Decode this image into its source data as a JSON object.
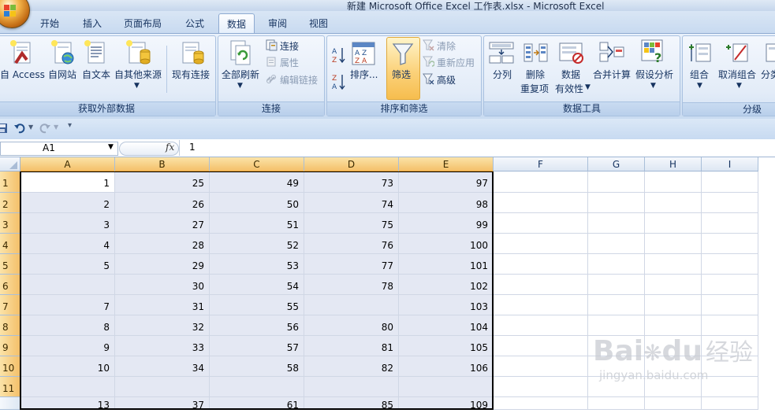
{
  "window": {
    "title": "新建 Microsoft Office Excel 工作表.xlsx - Microsoft Excel"
  },
  "tabs": [
    {
      "label": "开始"
    },
    {
      "label": "插入"
    },
    {
      "label": "页面布局"
    },
    {
      "label": "公式"
    },
    {
      "label": "数据",
      "active": true
    },
    {
      "label": "审阅"
    },
    {
      "label": "视图"
    }
  ],
  "ribbon": {
    "external": {
      "group_label": "获取外部数据",
      "access": "自 Access",
      "web": "自网站",
      "text": "自文本",
      "other": "自其他来源",
      "existing": "现有连接"
    },
    "connections": {
      "group_label": "连接",
      "refresh_all": "全部刷新",
      "connections": "连接",
      "properties": "属性",
      "edit_links": "编辑链接"
    },
    "sort_filter": {
      "group_label": "排序和筛选",
      "sort": "排序...",
      "filter": "筛选",
      "clear": "清除",
      "reapply": "重新应用",
      "advanced": "高级"
    },
    "data_tools": {
      "group_label": "数据工具",
      "text_to_columns": "分列",
      "remove_dup_1": "删除",
      "remove_dup_2": "重复项",
      "validation_1": "数据",
      "validation_2": "有效性",
      "consolidate": "合并计算",
      "what_if": "假设分析"
    },
    "outline": {
      "group_label": "分级",
      "group": "组合",
      "ungroup": "取消组合",
      "subtotal": "分类"
    }
  },
  "formula_bar": {
    "name_box": "A1",
    "fx": "fx",
    "value": "1"
  },
  "sheet": {
    "columns": [
      "A",
      "B",
      "C",
      "D",
      "E",
      "F",
      "G",
      "H",
      "I"
    ],
    "rows": [
      {
        "n": "1",
        "cells": [
          "1",
          "25",
          "49",
          "73",
          "97"
        ]
      },
      {
        "n": "2",
        "cells": [
          "2",
          "26",
          "50",
          "74",
          "98"
        ]
      },
      {
        "n": "3",
        "cells": [
          "3",
          "27",
          "51",
          "75",
          "99"
        ]
      },
      {
        "n": "4",
        "cells": [
          "4",
          "28",
          "52",
          "76",
          "100"
        ]
      },
      {
        "n": "5",
        "cells": [
          "5",
          "29",
          "53",
          "77",
          "101"
        ]
      },
      {
        "n": "6",
        "cells": [
          "",
          "30",
          "54",
          "78",
          "102"
        ]
      },
      {
        "n": "7",
        "cells": [
          "7",
          "31",
          "55",
          "",
          "103"
        ]
      },
      {
        "n": "8",
        "cells": [
          "8",
          "32",
          "56",
          "80",
          "104"
        ]
      },
      {
        "n": "9",
        "cells": [
          "9",
          "33",
          "57",
          "81",
          "105"
        ]
      },
      {
        "n": "10",
        "cells": [
          "10",
          "34",
          "58",
          "82",
          "106"
        ]
      },
      {
        "n": "11",
        "cells": [
          "",
          "",
          "",
          "",
          ""
        ]
      },
      {
        "n": "",
        "cells": [
          "13",
          "37",
          "61",
          "85",
          "109"
        ]
      }
    ]
  },
  "watermark": {
    "brand": "Bai",
    "brand2": "du",
    "cn": "经验",
    "url": "jingyan.baidu.com"
  },
  "colors": {
    "ribbon": "#dbe7f6",
    "selection": "#e4e8f3",
    "header_selected": "#f4c06a"
  }
}
